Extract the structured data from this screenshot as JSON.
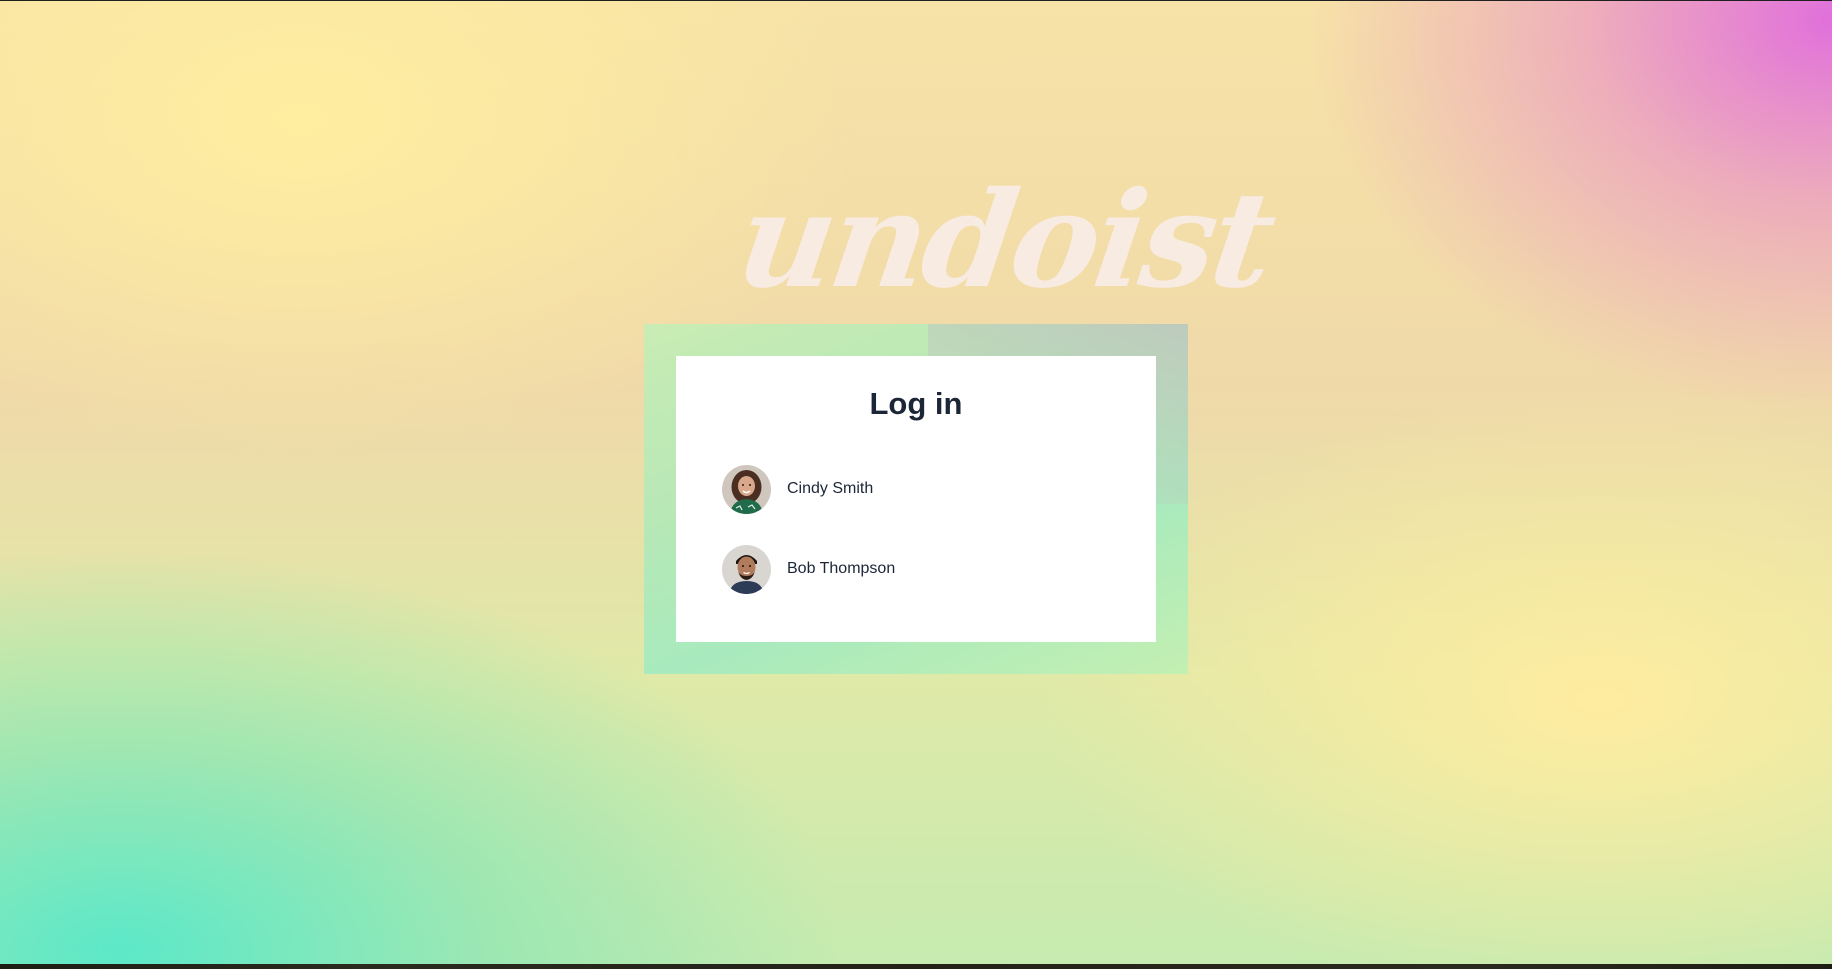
{
  "app": {
    "logo_text": "undoist"
  },
  "login": {
    "title": "Log in",
    "users": [
      {
        "name": "Cindy Smith",
        "avatar_icon": "cindy-avatar"
      },
      {
        "name": "Bob Thompson",
        "avatar_icon": "bob-avatar"
      }
    ]
  },
  "colors": {
    "accent_pink": "#e06ade",
    "accent_mint": "#5ce8c8",
    "accent_yellow": "#ffeea0",
    "text_dark": "#1c2637",
    "logo_color": "#f8ece6"
  }
}
